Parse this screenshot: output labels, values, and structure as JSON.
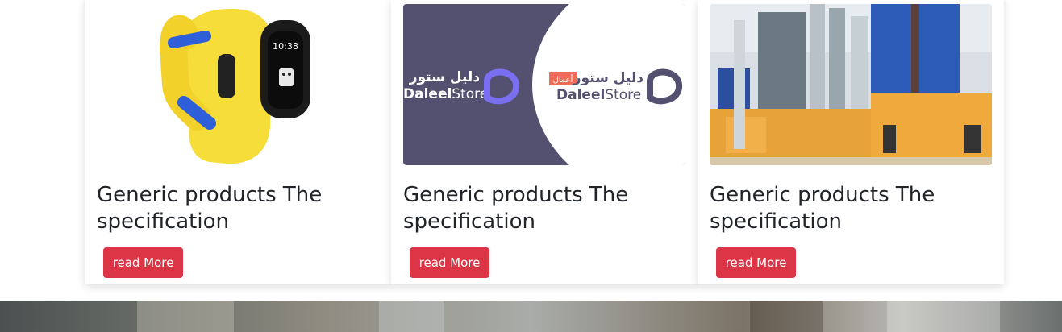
{
  "cards": [
    {
      "title": "Generic products The specification",
      "button": "read More",
      "image": "fitness-tracker-watch",
      "watch_time": "10:38"
    },
    {
      "title": "Generic products The specification",
      "button": "read More",
      "image": "daleel-store-logos",
      "logo_left": {
        "arabic": "دليل ستور",
        "latin_a": "Daleel",
        "latin_b": "Store"
      },
      "logo_right": {
        "arabic": "دليل ستور",
        "badge": "أعمال",
        "latin_a": "Daleel",
        "latin_b": "Store"
      }
    },
    {
      "title": "Generic products The specification",
      "button": "read More",
      "image": "industrial-plant"
    }
  ],
  "colors": {
    "button": "#dc3545",
    "logo_bg": "#54506f",
    "accent": "#7a6ff0",
    "watch_band": "#f7dd3a",
    "badge": "#ef6c57"
  }
}
